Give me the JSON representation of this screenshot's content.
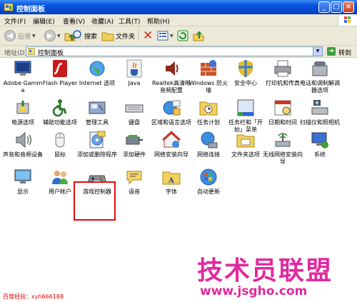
{
  "window": {
    "title": "控制面板"
  },
  "menu": [
    "文件(F)",
    "编辑(E)",
    "查看(V)",
    "收藏(A)",
    "工具(T)",
    "帮助(H)"
  ],
  "toolbar": {
    "back": "后退",
    "search": "搜索",
    "folders": "文件夹"
  },
  "address": {
    "label": "地址(D)",
    "value": "控制面板",
    "go": "转到"
  },
  "items": [
    {
      "label": "Adobe Gamma",
      "icon": "monitor-icon"
    },
    {
      "label": "Flash Player",
      "icon": "flash-icon"
    },
    {
      "label": "Internet 选项",
      "icon": "globe-icon"
    },
    {
      "label": "Java",
      "icon": "java-icon"
    },
    {
      "label": "Realtek高清晰音频配置",
      "icon": "speaker-icon"
    },
    {
      "label": "Windows 防火墙",
      "icon": "firewall-icon"
    },
    {
      "label": "安全中心",
      "icon": "shield-icon"
    },
    {
      "label": "打印机和传真",
      "icon": "printer-icon"
    },
    {
      "label": "电话和调制解调器选项",
      "icon": "phone-icon"
    },
    {
      "label": "电源选项",
      "icon": "power-icon"
    },
    {
      "label": "辅助功能选项",
      "icon": "accessibility-icon"
    },
    {
      "label": "管理工具",
      "icon": "tools-icon"
    },
    {
      "label": "键盘",
      "icon": "keyboard-icon"
    },
    {
      "label": "区域和语言选项",
      "icon": "region-icon"
    },
    {
      "label": "任务计划",
      "icon": "scheduled-tasks-icon"
    },
    {
      "label": "任务栏和「开始」菜单",
      "icon": "taskbar-icon"
    },
    {
      "label": "日期和时间",
      "icon": "clock-icon"
    },
    {
      "label": "扫描仪和照相机",
      "icon": "scanner-icon"
    },
    {
      "label": "声音和音频设备",
      "icon": "sound-icon"
    },
    {
      "label": "鼠标",
      "icon": "mouse-icon"
    },
    {
      "label": "添加或删除程序",
      "icon": "add-remove-icon"
    },
    {
      "label": "添加硬件",
      "icon": "hardware-icon"
    },
    {
      "label": "网络安装向导",
      "icon": "network-home-icon"
    },
    {
      "label": "网络连接",
      "icon": "network-icon"
    },
    {
      "label": "文件夹选项",
      "icon": "folder-icon"
    },
    {
      "label": "无线网络安装向导",
      "icon": "wireless-icon"
    },
    {
      "label": "系统",
      "icon": "system-icon"
    },
    {
      "label": "显示",
      "icon": "display-icon"
    },
    {
      "label": "用户帐户",
      "icon": "users-icon"
    },
    {
      "label": "游戏控制器",
      "icon": "gamepad-icon"
    },
    {
      "label": "语音",
      "icon": "speech-icon"
    },
    {
      "label": "字体",
      "icon": "fonts-icon"
    },
    {
      "label": "自动更新",
      "icon": "update-icon"
    }
  ],
  "watermark": {
    "title": "技术员联盟",
    "url": "www.jsgho.com"
  },
  "footer": "百度经验：xyh666168"
}
